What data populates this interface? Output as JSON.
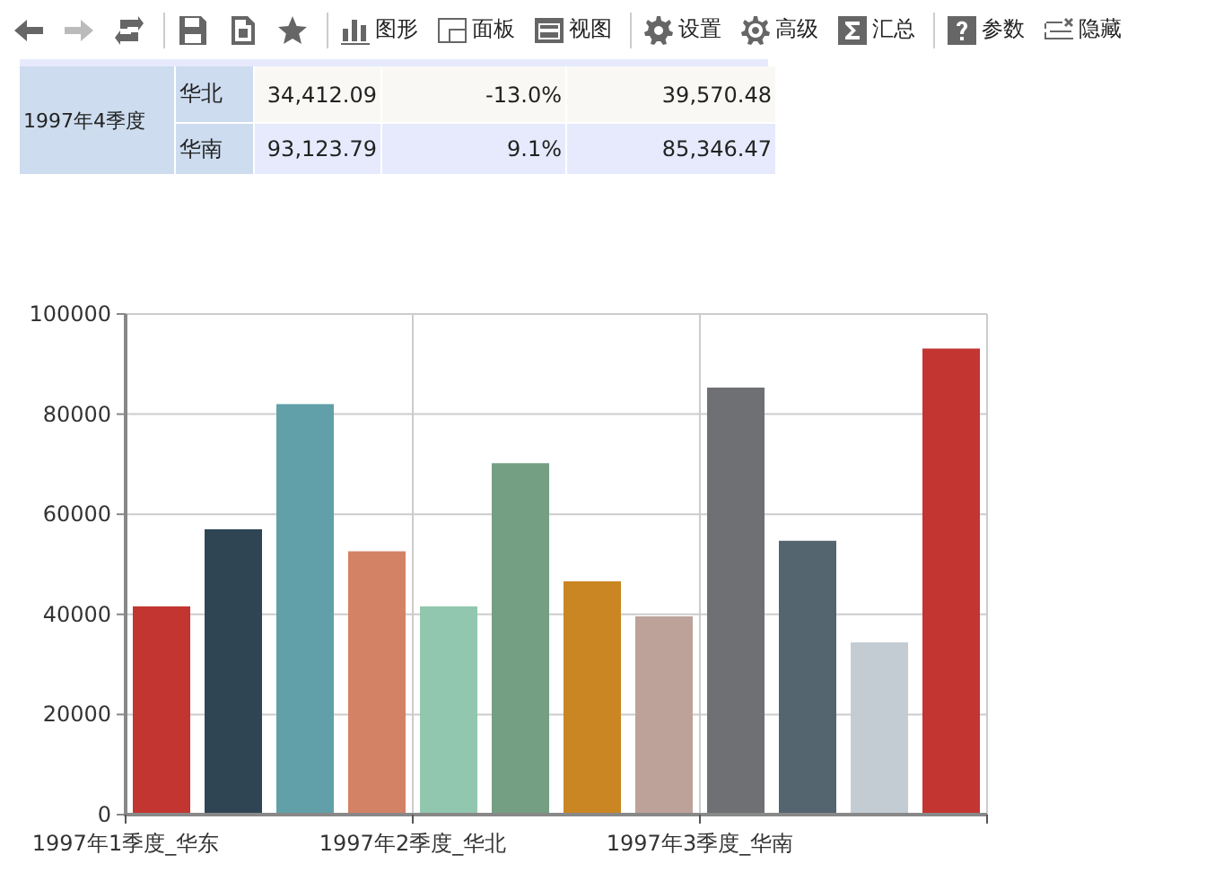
{
  "toolbar": [
    {
      "kind": "back",
      "disabled": false
    },
    {
      "kind": "forward",
      "disabled": true
    },
    {
      "kind": "refresh",
      "disabled": false
    },
    {
      "kind": "save",
      "disabled": false
    },
    {
      "kind": "export",
      "disabled": false
    },
    {
      "kind": "star",
      "disabled": false
    },
    {
      "kind": "chart",
      "label": "图形",
      "disabled": false
    },
    {
      "kind": "panel",
      "label": "面板",
      "disabled": false
    },
    {
      "kind": "view",
      "label": "视图",
      "disabled": false
    },
    {
      "kind": "gear",
      "label": "设置",
      "disabled": false
    },
    {
      "kind": "gear-outline",
      "label": "高级",
      "disabled": false
    },
    {
      "kind": "sum",
      "label": "汇总",
      "disabled": false
    },
    {
      "kind": "help",
      "label": "参数",
      "disabled": false
    },
    {
      "kind": "hide",
      "label": "隐藏",
      "disabled": false
    }
  ],
  "table": {
    "group": "1997年4季度",
    "rows": [
      {
        "region": "华北",
        "col_3": "34,412.09",
        "col_4": "-13.0%",
        "col_5": "39,570.48"
      },
      {
        "region": "华南",
        "col_3": "93,123.79",
        "col_4": "9.1%",
        "col_5": "85,346.47"
      }
    ]
  },
  "chart_data": {
    "type": "bar",
    "categories": [
      "1997年1季度_华东",
      null,
      null,
      null,
      "1997年2季度_华北",
      null,
      null,
      null,
      "1997年3季度_华南",
      null,
      null,
      null
    ],
    "grid": true,
    "ylim": [
      0,
      100000
    ],
    "yticks": [
      0,
      20000,
      40000,
      60000,
      80000,
      100000
    ],
    "values": [
      41600,
      57000,
      82000,
      52600,
      41600,
      70200,
      46600,
      39600,
      85300,
      54700,
      34400,
      93100
    ],
    "colors": [
      "#c23531",
      "#2f4554",
      "#61a0a8",
      "#d48265",
      "#91c7ae",
      "#749f83",
      "#ca8622",
      "#bda29a",
      "#6e7074",
      "#546570",
      "#c4ccd3",
      "#c23531"
    ]
  }
}
